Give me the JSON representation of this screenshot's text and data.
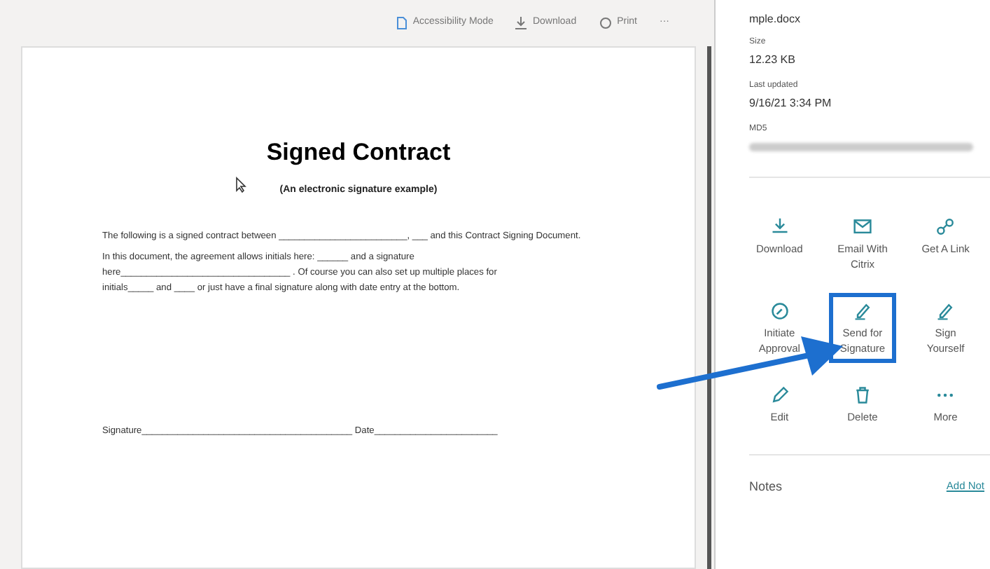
{
  "toolbar": [
    {
      "kind": "doc",
      "label": "Accessibility Mode"
    },
    {
      "kind": "download",
      "label": "Download"
    },
    {
      "kind": "print",
      "label": "Print"
    },
    {
      "kind": "more",
      "label": "···"
    }
  ],
  "document": {
    "title": "Signed Contract",
    "subtitle": "(An electronic signature example)",
    "paragraphs": [
      "The following is a signed contract between _________________________, ___ and this Contract Signing Document.",
      "In this document, the agreement allows initials here: ______ and a signature here_________________________________ . Of course you can also set up multiple places for initials_____ and ____ or just have a final signature along with date entry at the bottom."
    ],
    "signature_line": "Signature_________________________________________ Date________________________"
  },
  "details": {
    "filename": "mple.docx",
    "fields": [
      {
        "label": "Size",
        "value": "12.23 KB"
      },
      {
        "label": "Last updated",
        "value": "9/16/21 3:34 PM"
      },
      {
        "label": "MD5",
        "value_blurred": true
      }
    ]
  },
  "actions": [
    {
      "kind": "download",
      "label": "Download",
      "highlighted": false
    },
    {
      "kind": "mail",
      "label": "Email With Citrix",
      "highlighted": false
    },
    {
      "kind": "link",
      "label": "Get A Link",
      "highlighted": false
    },
    {
      "kind": "compass",
      "label": "Initiate Approval",
      "highlighted": false
    },
    {
      "kind": "pen",
      "label": "Send for Signature",
      "highlighted": true
    },
    {
      "kind": "pen",
      "label": "Sign Yourself",
      "highlighted": false
    },
    {
      "kind": "pencil",
      "label": "Edit",
      "highlighted": false
    },
    {
      "kind": "trash",
      "label": "Delete",
      "highlighted": false
    },
    {
      "kind": "dots",
      "label": "More",
      "highlighted": false
    }
  ],
  "notes": {
    "label": "Notes",
    "add_link": "Add Not"
  }
}
